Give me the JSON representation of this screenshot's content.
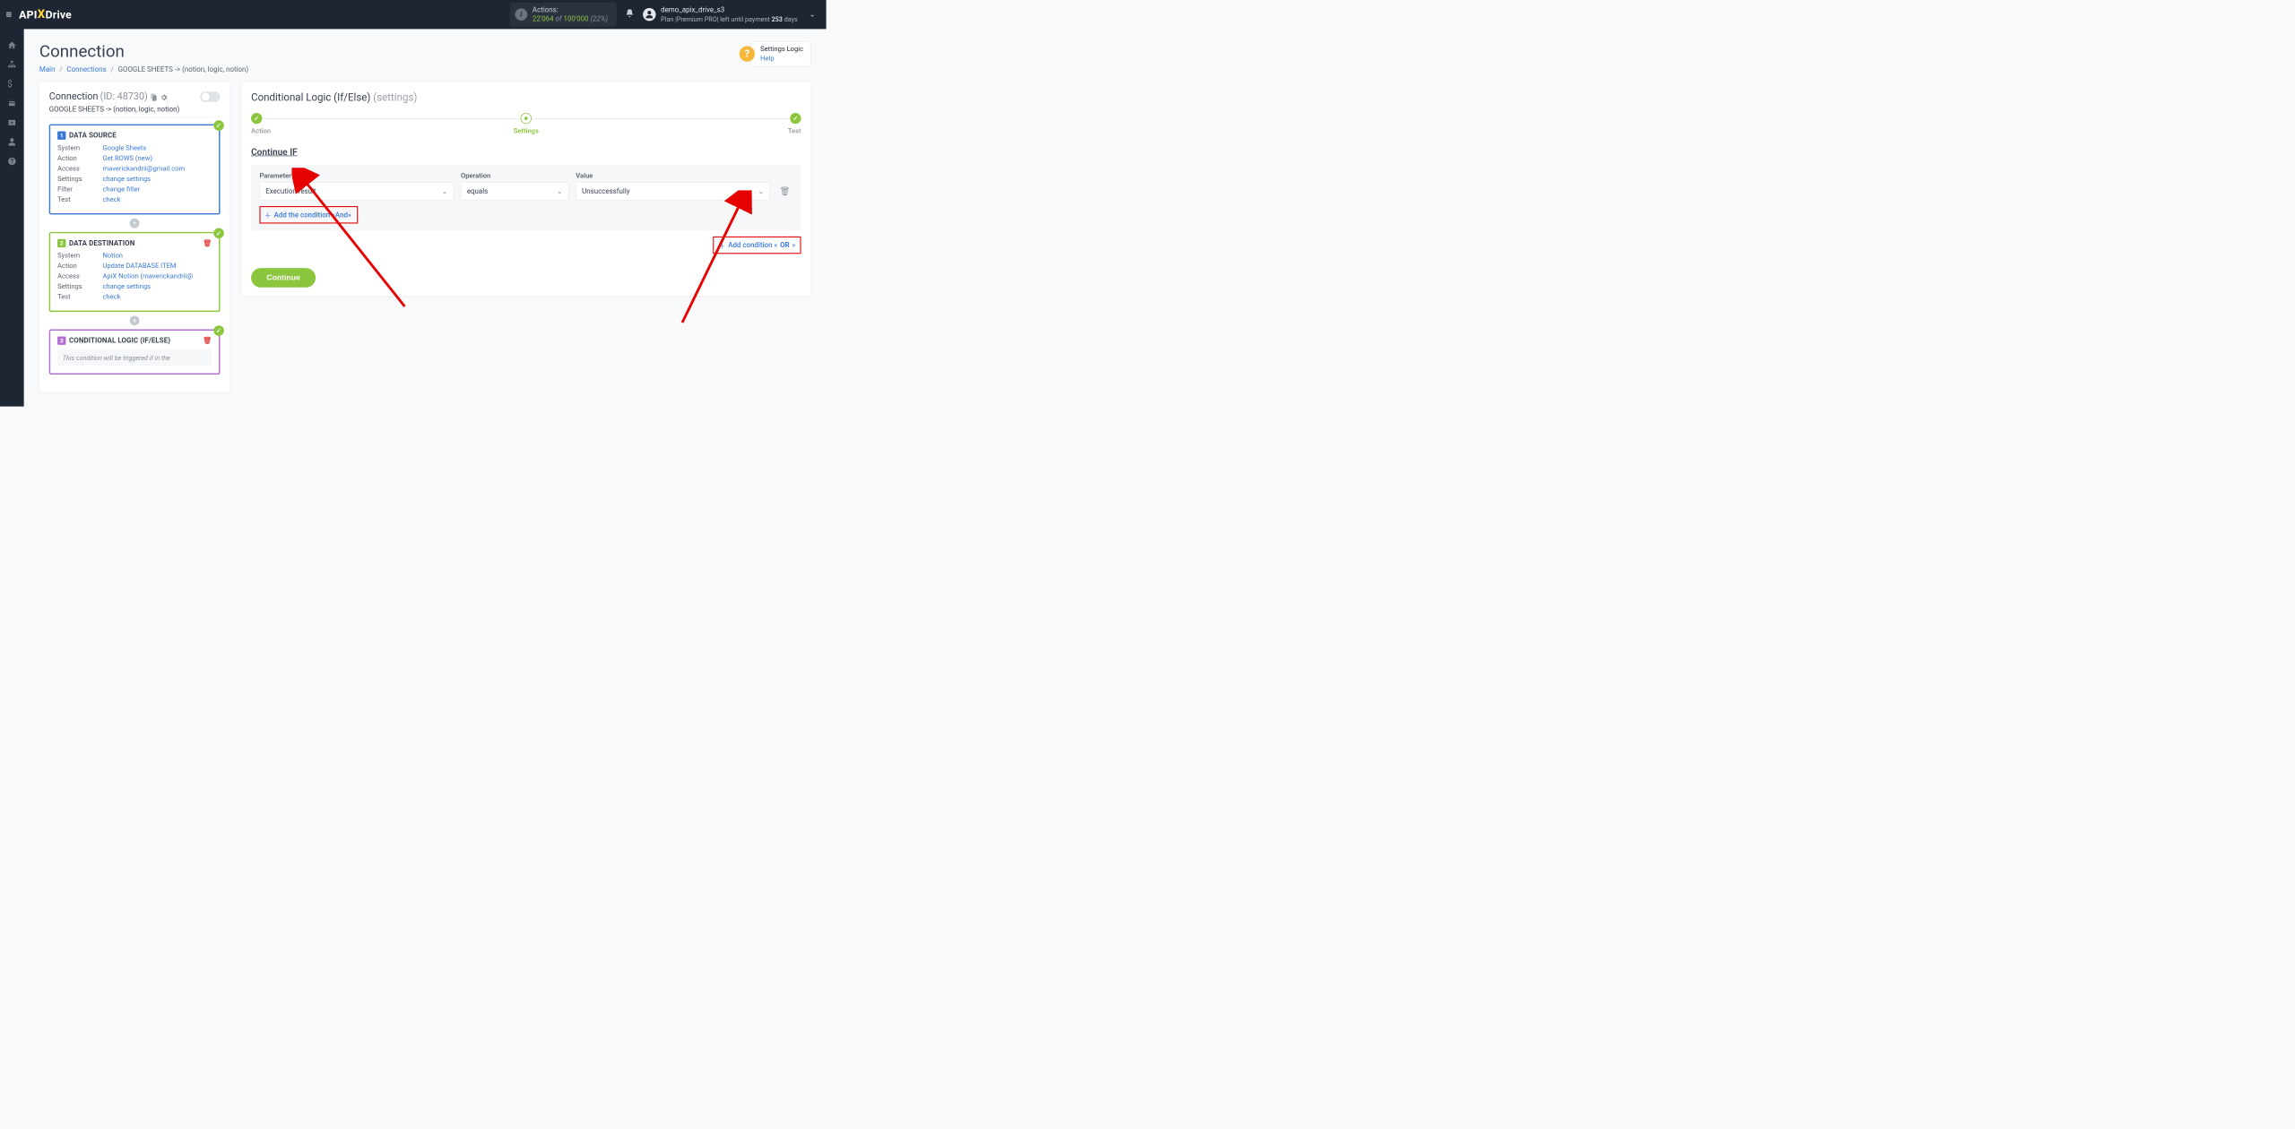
{
  "topbar": {
    "actions_label": "Actions:",
    "actions_done": "22'064",
    "actions_of": " of ",
    "actions_total": "100'000",
    "actions_pct": " (22%)",
    "username": "demo_apix_drive_s3",
    "plan_prefix": "Plan |Premium PRO| left until payment ",
    "plan_days": "253",
    "plan_suffix": " days"
  },
  "breadcrumb": {
    "page_title": "Connection",
    "main": "Main",
    "connections": "Connections",
    "current": "GOOGLE SHEETS -> (notion, logic, notion)"
  },
  "help": {
    "title": "Settings Logic",
    "link": "Help"
  },
  "left": {
    "title": "Connection",
    "id_label": "(ID: 48730)",
    "subtitle": "GOOGLE SHEETS -> (notion, logic, notion)",
    "source": {
      "title": "DATA SOURCE",
      "system_label": "System",
      "system_value": "Google Sheets",
      "action_label": "Action",
      "action_value": "Get ROWS (new)",
      "access_label": "Access",
      "access_value": "maverickandrii@gmail.com",
      "settings_label": "Settings",
      "settings_value": "change settings",
      "filter_label": "Filter",
      "filter_value": "change filter",
      "test_label": "Test",
      "test_value": "check"
    },
    "dest": {
      "title": "DATA DESTINATION",
      "system_label": "System",
      "system_value": "Notion",
      "action_label": "Action",
      "action_value": "Update DATABASE ITEM",
      "access_label": "Access",
      "access_value": "ApiX Notion (maverickandrii@",
      "settings_label": "Settings",
      "settings_value": "change settings",
      "test_label": "Test",
      "test_value": "check"
    },
    "logic": {
      "title": "CONDITIONAL LOGIC (IF/ELSE)",
      "desc": "This condition will be triggered if in the"
    }
  },
  "right": {
    "title": "Conditional Logic (If/Else)",
    "title_muted": "(settings)",
    "steps": {
      "a": "Action",
      "b": "Settings",
      "c": "Test"
    },
    "section": "Continue IF",
    "col_param": "Parameter",
    "col_op": "Operation",
    "col_val": "Value",
    "param_value": "Execution result",
    "op_value": "equals",
    "val_value": "Unsuccessfully",
    "add_and": "Add the condition «And»",
    "add_or_prefix": "Add condition «",
    "add_or_bold": "OR",
    "add_or_suffix": "»",
    "continue": "Continue"
  }
}
